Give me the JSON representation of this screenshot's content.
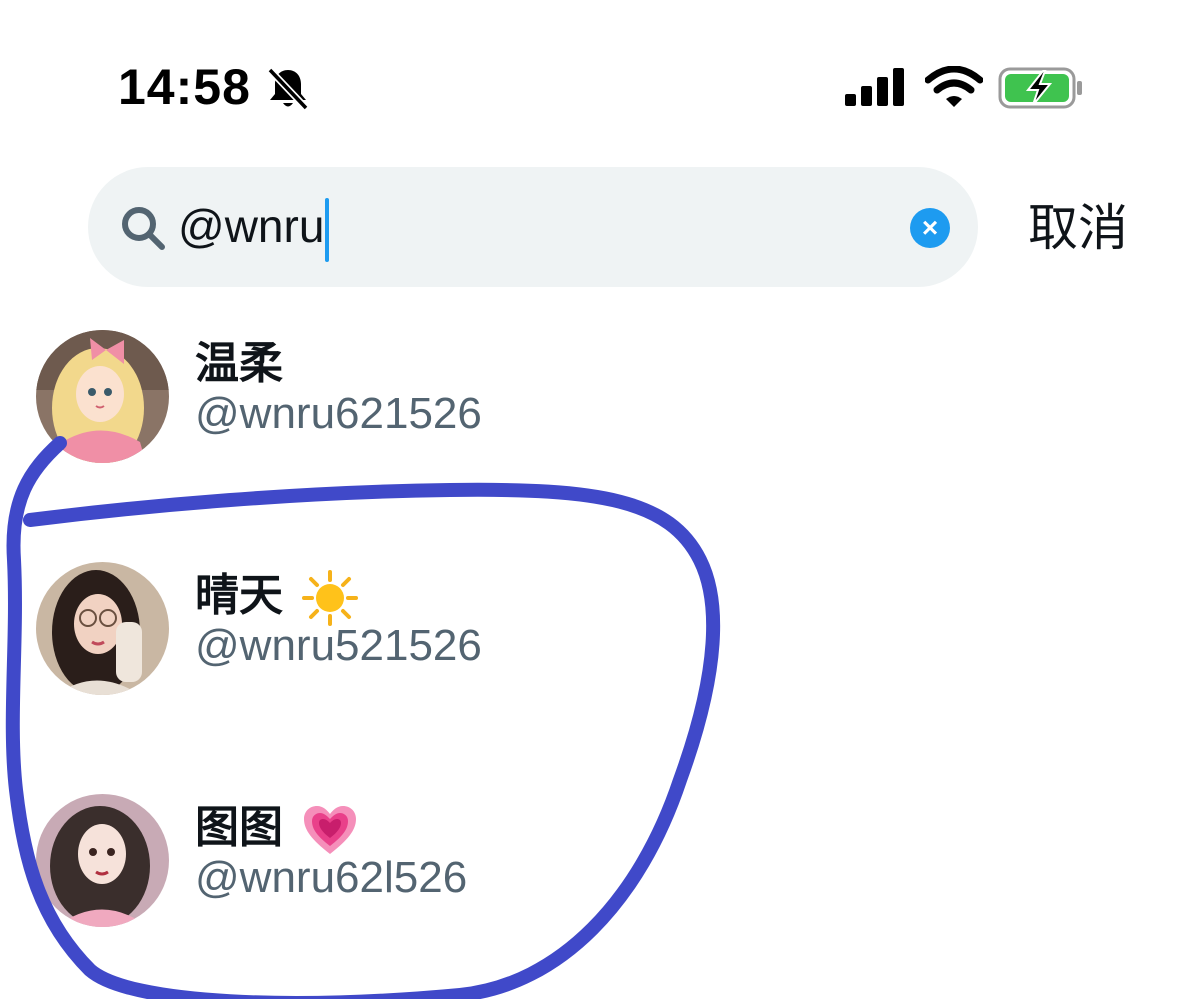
{
  "status_bar": {
    "time": "14:58",
    "icons": [
      "bell-slash-icon",
      "cellular-signal-icon",
      "wifi-icon",
      "battery-charging-icon"
    ]
  },
  "search": {
    "query": "@wnru",
    "clear_icon": "clear-icon",
    "cancel_label": "取消"
  },
  "results": [
    {
      "name": "温柔",
      "emoji": "",
      "handle": "@wnru621526",
      "avatar_color": "#e9a7b9"
    },
    {
      "name": "晴天",
      "emoji": "sun-emoji",
      "handle": "@wnru521526",
      "avatar_color": "#c9b29a"
    },
    {
      "name": "图图",
      "emoji": "growing-heart-emoji",
      "handle": "@wnru62l526",
      "avatar_color": "#d9a9b8"
    }
  ],
  "colors": {
    "accent": "#1d9bf0",
    "handle_text": "#536471",
    "search_bg": "#eff3f4",
    "annotation_stroke": "#4049c9"
  }
}
